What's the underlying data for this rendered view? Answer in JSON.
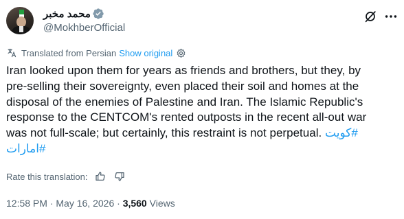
{
  "author": {
    "display_name": "محمد مخبر",
    "handle": "@MokhberOfficial",
    "verified_color": "#829aab"
  },
  "translation": {
    "label": "Translated from Persian",
    "show_original": "Show original"
  },
  "tweet": {
    "lines": [
      "Iran looked upon them for years as friends and brothers, but they, by",
      "pre-selling their sovereignty, even placed their soil and homes at the",
      "disposal of the enemies of Palestine and Iran.  The Islamic Republic's",
      "response to the CENTCOM's rented outposts in the recent all-out war",
      "was not full-scale; but certainly, this restraint is not perpetual. "
    ],
    "hashtags": [
      "#کویت",
      "#امارات"
    ]
  },
  "rate": {
    "label": "Rate this translation:"
  },
  "meta": {
    "time": "12:58 PM",
    "separator": "·",
    "date": "May 16, 2026",
    "views_count": "3,560",
    "views_label": "Views"
  },
  "colors": {
    "link": "#1d9bf0",
    "secondary_text": "#536471",
    "primary_text": "#0f1419"
  }
}
